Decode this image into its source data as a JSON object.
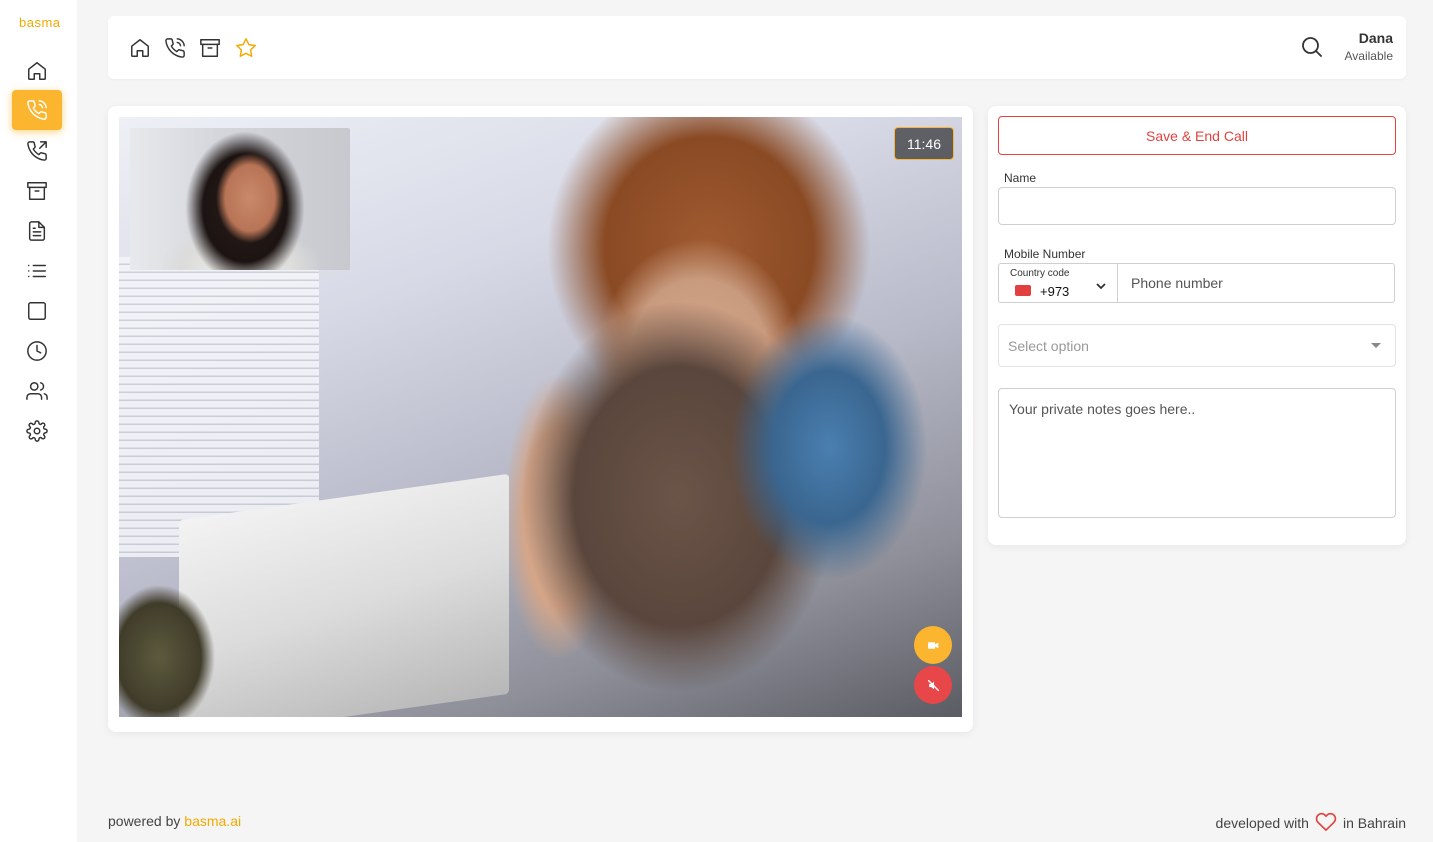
{
  "app": {
    "logo": "basma"
  },
  "sidebar": {
    "items": [
      {
        "icon": "home-icon"
      },
      {
        "icon": "phone-call-icon",
        "active": true
      },
      {
        "icon": "phone-outgoing-icon"
      },
      {
        "icon": "archive-icon"
      },
      {
        "icon": "document-icon"
      },
      {
        "icon": "list-icon"
      },
      {
        "icon": "square-icon"
      },
      {
        "icon": "clock-icon"
      },
      {
        "icon": "users-icon"
      },
      {
        "icon": "settings-icon"
      }
    ]
  },
  "header": {
    "icons": [
      "home-icon",
      "phone-call-icon",
      "archive-icon",
      "star-icon"
    ],
    "user": {
      "name": "Dana",
      "status": "Available"
    }
  },
  "call": {
    "timer": "11:46"
  },
  "form": {
    "save_label": "Save & End Call",
    "name_label": "Name",
    "name_value": "",
    "mobile_label": "Mobile Number",
    "country_code_label": "Country code",
    "country_code_value": "+973",
    "phone_placeholder": "Phone number",
    "select_placeholder": "Select option",
    "notes_placeholder": "Your private notes goes here.."
  },
  "footer": {
    "powered_prefix": "powered by ",
    "powered_brand": "basma.ai",
    "developed_prefix": "developed with",
    "developed_suffix": "in Bahrain"
  },
  "colors": {
    "accent": "#fbb52f",
    "danger": "#e04340",
    "brand_text": "#f2a900"
  }
}
